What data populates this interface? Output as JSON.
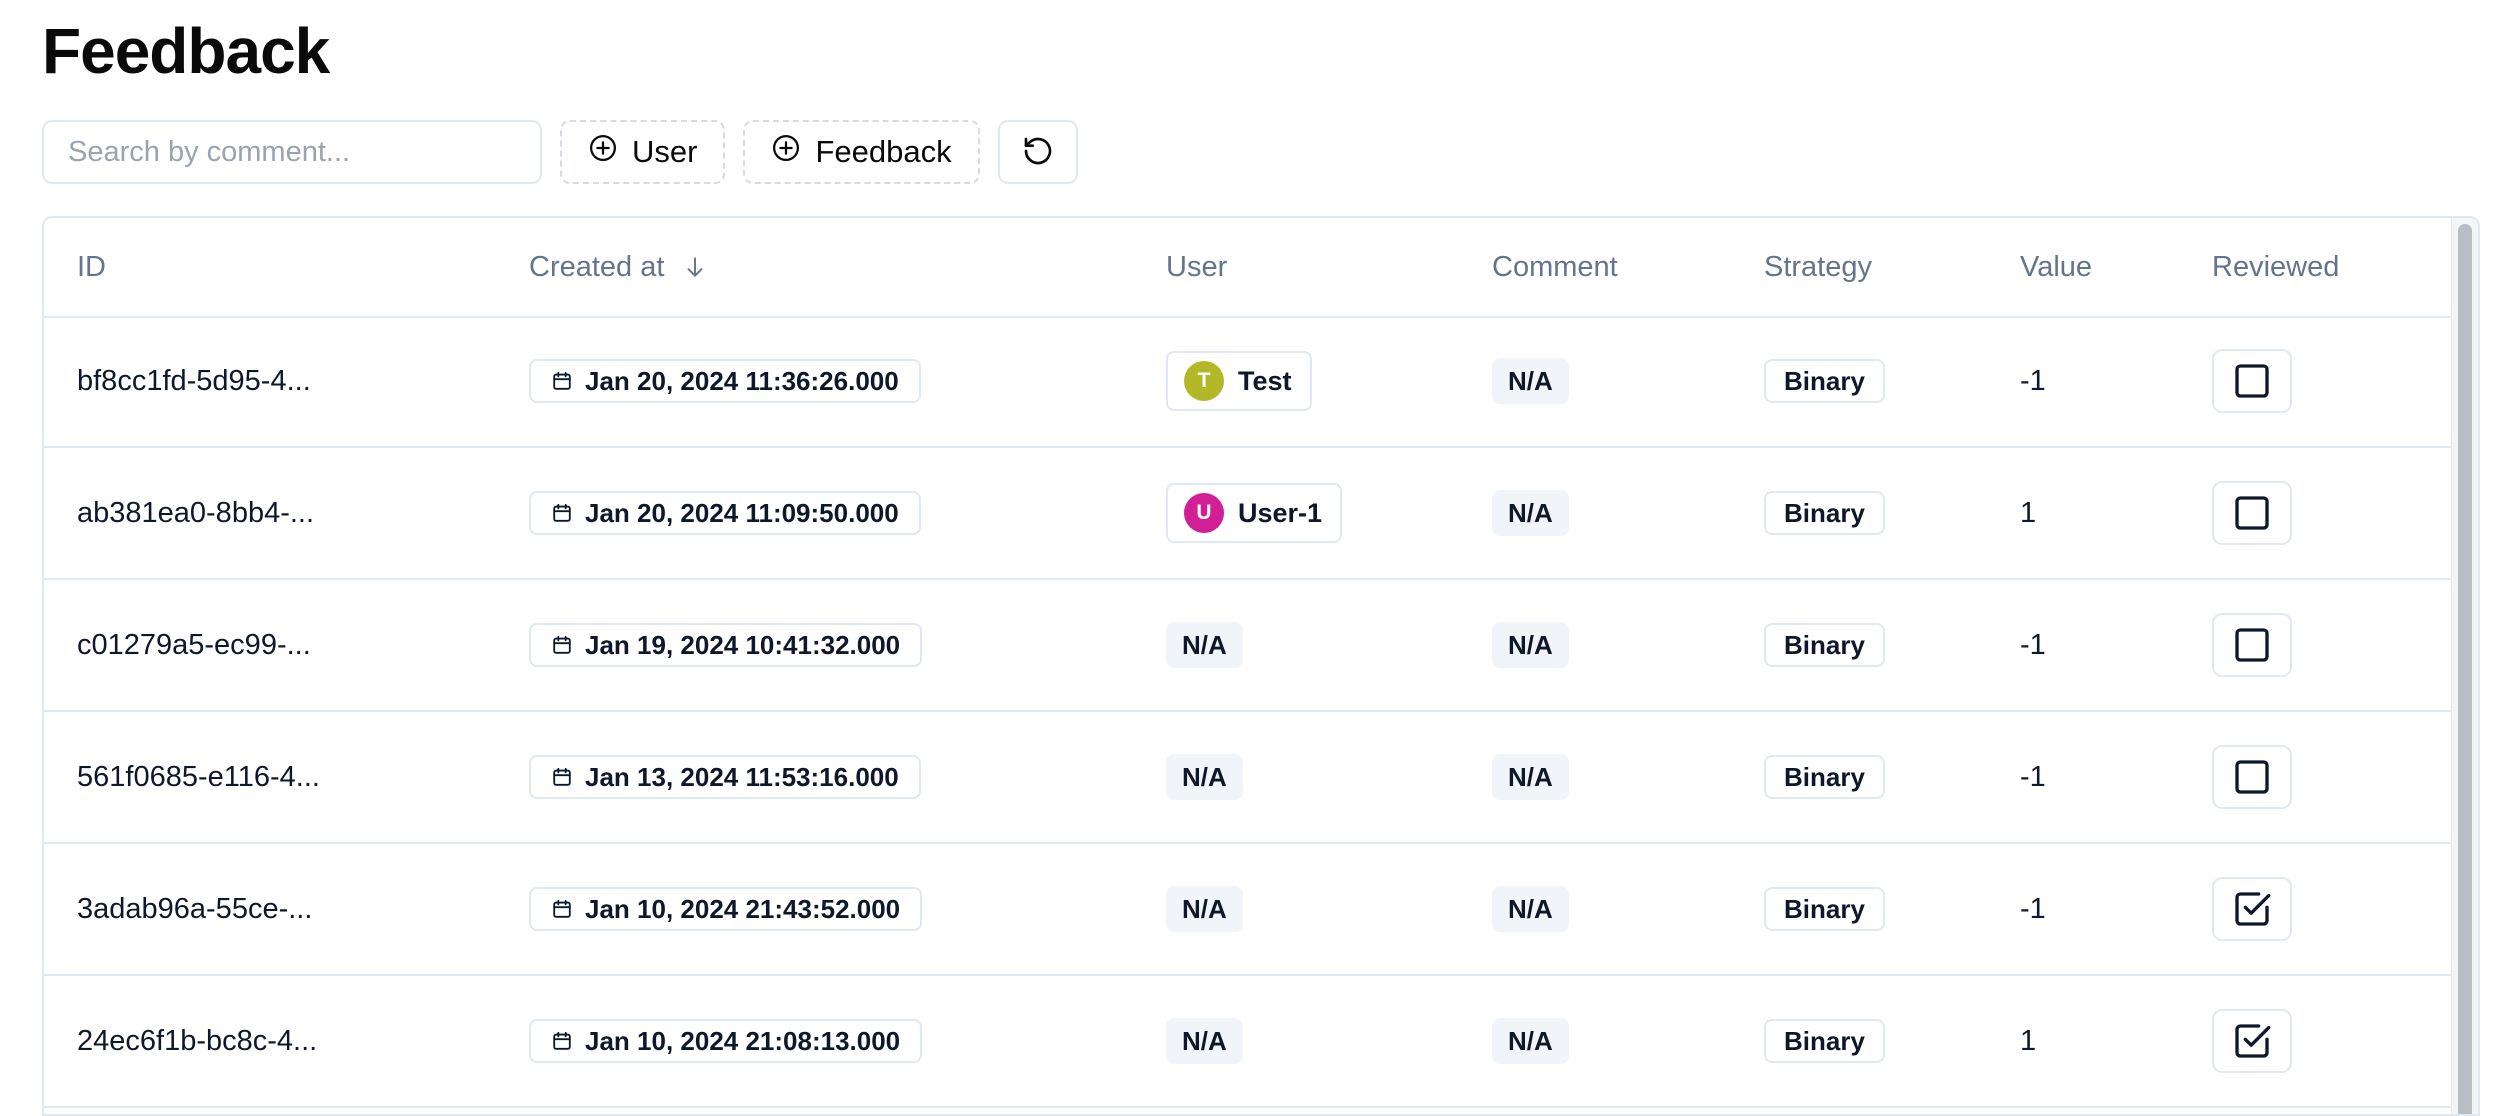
{
  "page": {
    "title": "Feedback"
  },
  "toolbar": {
    "search_placeholder": "Search by comment...",
    "search_value": "",
    "filters": [
      {
        "label": "User",
        "icon": "plus-circle-icon"
      },
      {
        "label": "Feedback",
        "icon": "plus-circle-icon"
      }
    ],
    "reset_icon": "rotate-ccw-icon"
  },
  "table": {
    "columns": [
      {
        "label": "ID"
      },
      {
        "label": "Created at",
        "sort": "descending",
        "sort_icon": "arrow-down-icon"
      },
      {
        "label": "User"
      },
      {
        "label": "Comment"
      },
      {
        "label": "Strategy"
      },
      {
        "label": "Value"
      },
      {
        "label": "Reviewed"
      }
    ],
    "rows": [
      {
        "id": "bf8cc1fd-5d95-4...",
        "created_at": "Jan 20, 2024 11:36:26.000",
        "user": {
          "name": "Test",
          "initial": "T",
          "color": "#b3b829"
        },
        "comment": "N/A",
        "strategy": "Binary",
        "value": "-1",
        "reviewed": false
      },
      {
        "id": "ab381ea0-8bb4-...",
        "created_at": "Jan 20, 2024 11:09:50.000",
        "user": {
          "name": "User-1",
          "initial": "U",
          "color": "#d21f96"
        },
        "comment": "N/A",
        "strategy": "Binary",
        "value": "1",
        "reviewed": false
      },
      {
        "id": "c01279a5-ec99-...",
        "created_at": "Jan 19, 2024 10:41:32.000",
        "user": {
          "name": "N/A"
        },
        "comment": "N/A",
        "strategy": "Binary",
        "value": "-1",
        "reviewed": false
      },
      {
        "id": "561f0685-e116-4...",
        "created_at": "Jan 13, 2024 11:53:16.000",
        "user": {
          "name": "N/A"
        },
        "comment": "N/A",
        "strategy": "Binary",
        "value": "-1",
        "reviewed": false
      },
      {
        "id": "3adab96a-55ce-...",
        "created_at": "Jan 10, 2024 21:43:52.000",
        "user": {
          "name": "N/A"
        },
        "comment": "N/A",
        "strategy": "Binary",
        "value": "-1",
        "reviewed": true
      },
      {
        "id": "24ec6f1b-bc8c-4...",
        "created_at": "Jan 10, 2024 21:08:13.000",
        "user": {
          "name": "N/A"
        },
        "comment": "N/A",
        "strategy": "Binary",
        "value": "1",
        "reviewed": true
      }
    ]
  }
}
